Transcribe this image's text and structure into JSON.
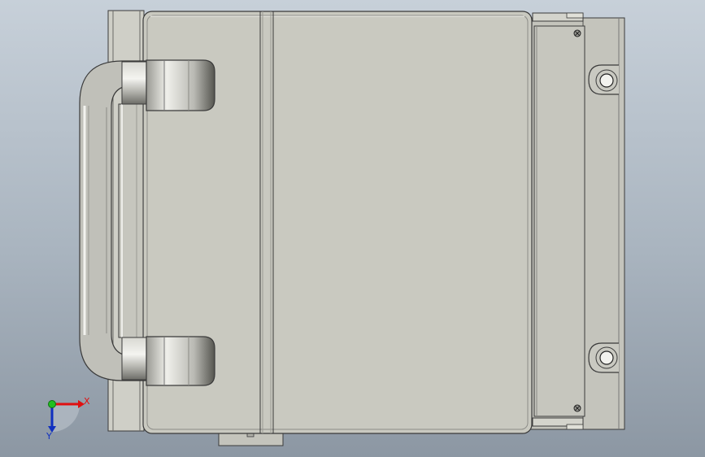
{
  "viewport": {
    "background_top": "#c7d0d9",
    "background_bottom": "#8c97a3"
  },
  "model": {
    "body_color": "#c9c9c0",
    "edge_color": "#3a3a3a",
    "handle_color": "#bdbdb6",
    "bracket_color": "#c4c4bc"
  },
  "triad": {
    "x_label": "X",
    "y_label": "Y",
    "x_color": "#e01010",
    "y_color": "#1030c0",
    "origin_color": "#20c020"
  }
}
